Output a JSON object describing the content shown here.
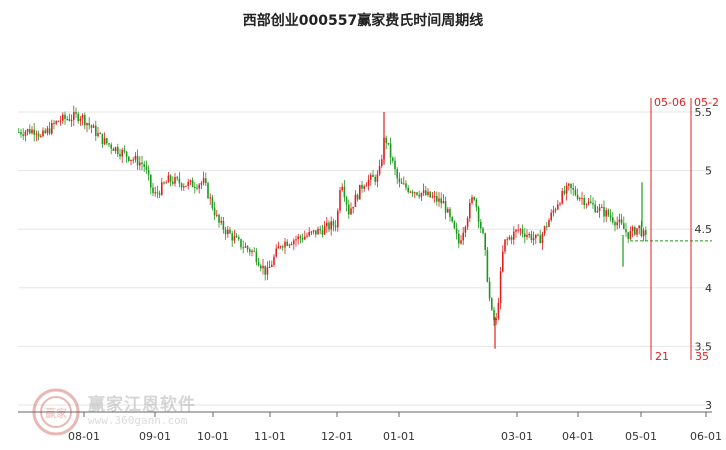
{
  "chart_data": {
    "type": "candlestick",
    "title": "西部创业000557赢家费氏时间周期线",
    "yticks": [
      "3",
      "3.5",
      "4",
      "4.5",
      "5",
      "5.5"
    ],
    "ylim": [
      3,
      5.6
    ],
    "xticks": [
      "08-01",
      "09-01",
      "10-01",
      "11-01",
      "12-01",
      "01-01",
      "03-01",
      "04-01",
      "05-01",
      "06-01"
    ],
    "cycle_lines": [
      {
        "date": "05-06",
        "count": "21"
      },
      {
        "date": "05-2",
        "count": "35"
      }
    ],
    "series": [
      {
        "ohlc": []
      }
    ],
    "colors": {
      "up": "#e02020",
      "down": "#1a9a1a",
      "cycle": "#e02020",
      "grid": "#e6e6e6",
      "forecast": "#1a9a1a"
    }
  },
  "watermark": {
    "logo_text": "赢家",
    "brand": "赢家江恩软件",
    "url": "www.360gann.com"
  }
}
